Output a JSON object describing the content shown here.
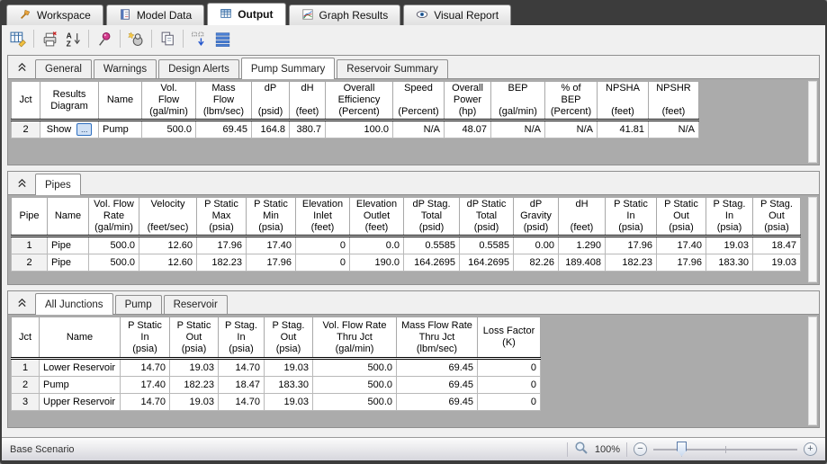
{
  "nav": {
    "tabs": [
      {
        "label": "Workspace"
      },
      {
        "label": "Model Data"
      },
      {
        "label": "Output"
      },
      {
        "label": "Graph Results"
      },
      {
        "label": "Visual Report"
      }
    ]
  },
  "toolbar": {
    "icons": [
      "output-display-options",
      "print",
      "sort-az",
      "pin",
      "format-wizard",
      "copy",
      "transfer-results",
      "show-rows"
    ]
  },
  "summary_section": {
    "tabs": [
      "General",
      "Warnings",
      "Design Alerts",
      "Pump Summary",
      "Reservoir Summary"
    ],
    "active_tab": "Pump Summary",
    "table": {
      "columns": [
        "Jct",
        "Results\nDiagram",
        "Name",
        "Vol.\nFlow\n(gal/min)",
        "Mass\nFlow\n(lbm/sec)",
        "dP\n\n(psid)",
        "dH\n\n(feet)",
        "Overall\nEfficiency\n(Percent)",
        "Speed\n\n(Percent)",
        "Overall\nPower\n(hp)",
        "BEP\n\n(gal/min)",
        "% of\nBEP\n(Percent)",
        "NPSHA\n\n(feet)",
        "NPSHR\n\n(feet)"
      ],
      "widths": [
        32,
        65,
        48,
        60,
        62,
        42,
        40,
        75,
        57,
        52,
        60,
        58,
        57,
        56
      ],
      "aligns": [
        "center",
        "center",
        "left",
        "right",
        "right",
        "right",
        "right",
        "right",
        "right",
        "right",
        "right",
        "right",
        "right",
        "right"
      ],
      "rows": [
        [
          "2",
          {
            "text": "Show",
            "button": "..."
          },
          "Pump",
          "500.0",
          "69.45",
          "164.8",
          "380.7",
          "100.0",
          "N/A",
          "48.07",
          "N/A",
          "N/A",
          "41.81",
          "N/A"
        ]
      ]
    }
  },
  "pipes_section": {
    "tabs": [
      "Pipes"
    ],
    "active_tab": "Pipes",
    "table": {
      "columns": [
        "Pipe",
        "Name",
        "Vol. Flow\nRate\n(gal/min)",
        "Velocity\n\n(feet/sec)",
        "P Static\nMax\n(psia)",
        "P Static\nMin\n(psia)",
        "Elevation\nInlet\n(feet)",
        "Elevation\nOutlet\n(feet)",
        "dP Stag.\nTotal\n(psid)",
        "dP Static\nTotal\n(psid)",
        "dP\nGravity\n(psid)",
        "dH\n\n(feet)",
        "P Static\nIn\n(psia)",
        "P Static\nOut\n(psia)",
        "P Stag.\nIn\n(psia)",
        "P Stag.\nOut\n(psia)"
      ],
      "widths": [
        40,
        46,
        56,
        64,
        55,
        55,
        60,
        60,
        62,
        60,
        50,
        52,
        57,
        55,
        52,
        53
      ],
      "aligns": [
        "center",
        "left",
        "right",
        "right",
        "right",
        "right",
        "right",
        "right",
        "right",
        "right",
        "right",
        "right",
        "right",
        "right",
        "right",
        "right"
      ],
      "rows": [
        [
          "1",
          "Pipe",
          "500.0",
          "12.60",
          "17.96",
          "17.40",
          "0",
          "0.0",
          "0.5585",
          "0.5585",
          "0.00",
          "1.290",
          "17.96",
          "17.40",
          "19.03",
          "18.47"
        ],
        [
          "2",
          "Pipe",
          "500.0",
          "12.60",
          "182.23",
          "17.96",
          "0",
          "190.0",
          "164.2695",
          "164.2695",
          "82.26",
          "189.408",
          "182.23",
          "17.96",
          "183.30",
          "19.03"
        ]
      ]
    }
  },
  "junctions_section": {
    "tabs": [
      "All Junctions",
      "Pump",
      "Reservoir"
    ],
    "active_tab": "All Junctions",
    "table": {
      "columns": [
        "Jct",
        "Name",
        "P Static\nIn\n(psia)",
        "P Static\nOut\n(psia)",
        "P Stag.\nIn\n(psia)",
        "P Stag.\nOut\n(psia)",
        "Vol. Flow Rate\nThru Jct\n(gal/min)",
        "Mass Flow Rate\nThru Jct\n(lbm/sec)",
        "Loss Factor\n(K)"
      ],
      "widths": [
        31,
        90,
        55,
        54,
        51,
        54,
        93,
        90,
        70
      ],
      "aligns": [
        "center",
        "left",
        "right",
        "right",
        "right",
        "right",
        "right",
        "right",
        "right"
      ],
      "rows": [
        [
          "1",
          "Lower Reservoir",
          "14.70",
          "19.03",
          "14.70",
          "19.03",
          "500.0",
          "69.45",
          "0"
        ],
        [
          "2",
          "Pump",
          "17.40",
          "182.23",
          "18.47",
          "183.30",
          "500.0",
          "69.45",
          "0"
        ],
        [
          "3",
          "Upper Reservoir",
          "14.70",
          "19.03",
          "14.70",
          "19.03",
          "500.0",
          "69.45",
          "0"
        ]
      ]
    }
  },
  "status_bar": {
    "scenario": "Base Scenario",
    "zoom_level": "100%"
  }
}
